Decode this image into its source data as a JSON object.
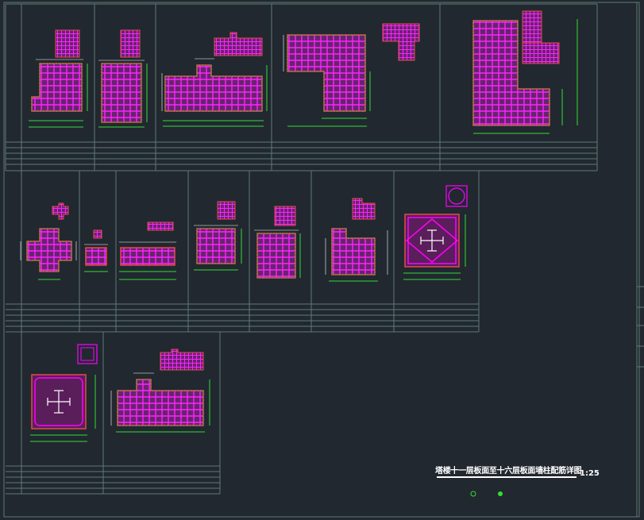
{
  "drawing": {
    "title": "塔楼十一层板面至十六层板面墙柱配筋详图",
    "scale": "1:25"
  },
  "colors": {
    "background": "#212830",
    "frame": "#5f7a72",
    "rebar": "#ff00ff",
    "concrete": "#e24b4b",
    "dimension": "#33dd33",
    "text": "#ffffff",
    "steel_section": "#ffffff"
  },
  "panels": {
    "row1": [
      "column-detail-1",
      "column-detail-2",
      "column-detail-3",
      "column-detail-4",
      "column-detail-5"
    ],
    "row2": [
      "column-detail-6",
      "column-detail-7",
      "column-detail-8",
      "column-detail-9",
      "column-detail-10",
      "column-detail-11",
      "column-detail-12"
    ],
    "row3": [
      "column-detail-13",
      "column-detail-14"
    ]
  }
}
